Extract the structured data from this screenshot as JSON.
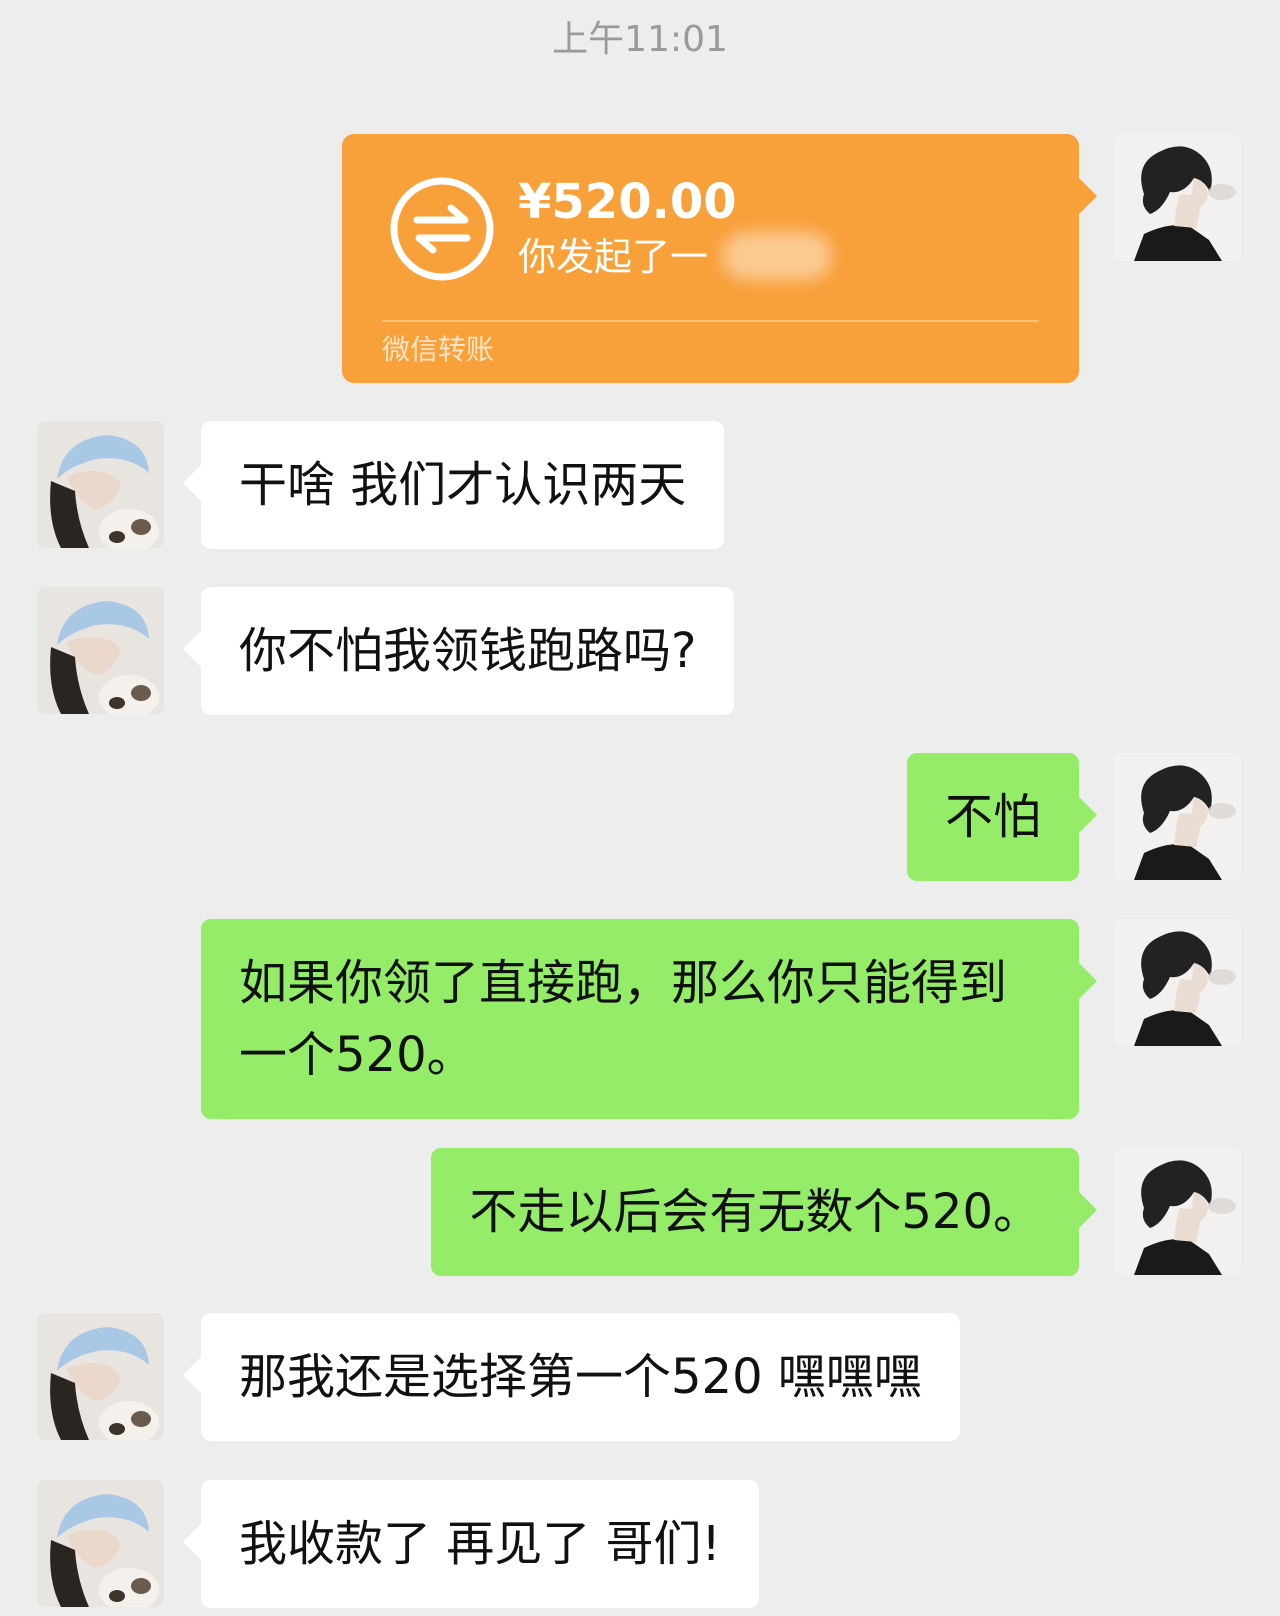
{
  "timestamp": "上午11:01",
  "transfer": {
    "amount": "¥520.00",
    "description": "你发起了一",
    "footer": "微信转账",
    "color": "#f8a03a"
  },
  "messages": [
    {
      "sender": "her",
      "text": "干啥 我们才认识两天"
    },
    {
      "sender": "her",
      "text": "你不怕我领钱跑路吗?"
    },
    {
      "sender": "me",
      "text": "不怕"
    },
    {
      "sender": "me",
      "text": "如果你领了直接跑，那么你只能得到一个520。"
    },
    {
      "sender": "me",
      "text": "不走以后会有无数个520。"
    },
    {
      "sender": "her",
      "text": "那我还是选择第一个520 嘿嘿嘿"
    },
    {
      "sender": "her",
      "text": "我收款了 再见了 哥们!"
    }
  ],
  "colors": {
    "background": "#ededed",
    "my_bubble": "#95ec69",
    "her_bubble": "#ffffff"
  }
}
